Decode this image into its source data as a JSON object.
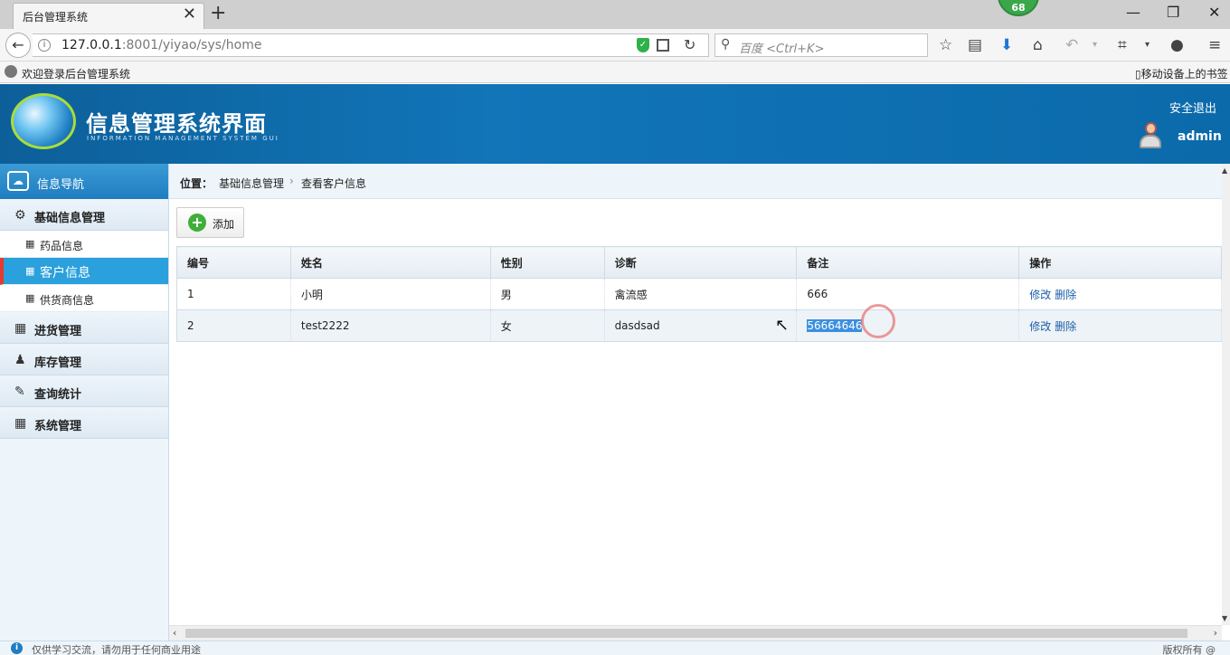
{
  "browser": {
    "tab_title": "后台管理系统",
    "tab_close": "✕",
    "new_tab": "+",
    "badge": "68",
    "window_controls": {
      "minimize": "—",
      "restore": "❐",
      "close": "✕"
    },
    "url_host": "127.0.0.1",
    "url_rest": ":8001/yiyao/sys/home",
    "search_placeholder": "百度 <Ctrl+K>",
    "bookmark_label": "欢迎登录后台管理系统",
    "mobile_bookmarks": "移动设备上的书签"
  },
  "header": {
    "title": "信息管理系统界面",
    "subtitle": "INFORMATION MANAGEMENT SYSTEM GUI",
    "logout": "安全退出",
    "username": "admin"
  },
  "sidebar": {
    "heading": "信息导航",
    "groups": [
      {
        "label": "基础信息管理",
        "icon": "gears-icon"
      },
      {
        "label": "进货管理",
        "icon": "calendar-icon"
      },
      {
        "label": "库存管理",
        "icon": "users-icon"
      },
      {
        "label": "查询统计",
        "icon": "edit-icon"
      },
      {
        "label": "系统管理",
        "icon": "calendar-icon"
      }
    ],
    "items": [
      {
        "label": "药品信息",
        "active": false
      },
      {
        "label": "客户信息",
        "active": true
      },
      {
        "label": "供货商信息",
        "active": false
      }
    ]
  },
  "breadcrumb": {
    "prefix": "位置：",
    "level1": "基础信息管理",
    "separator": "›",
    "level2": "查看客户信息"
  },
  "toolbar": {
    "add_label": "添加"
  },
  "table": {
    "headers": [
      "编号",
      "姓名",
      "性别",
      "诊断",
      "备注",
      "操作"
    ],
    "rows": [
      {
        "id": "1",
        "name": "小明",
        "gender": "男",
        "diagnosis": "禽流感",
        "remark": "666",
        "edit": "修改",
        "delete": "删除"
      },
      {
        "id": "2",
        "name": "test2222",
        "gender": "女",
        "diagnosis": "dasdsad",
        "remark": "56664646",
        "edit": "修改",
        "delete": "删除"
      }
    ]
  },
  "footer": {
    "notice": "仅供学习交流，请勿用于任何商业用途",
    "copyright": "版权所有 @"
  }
}
